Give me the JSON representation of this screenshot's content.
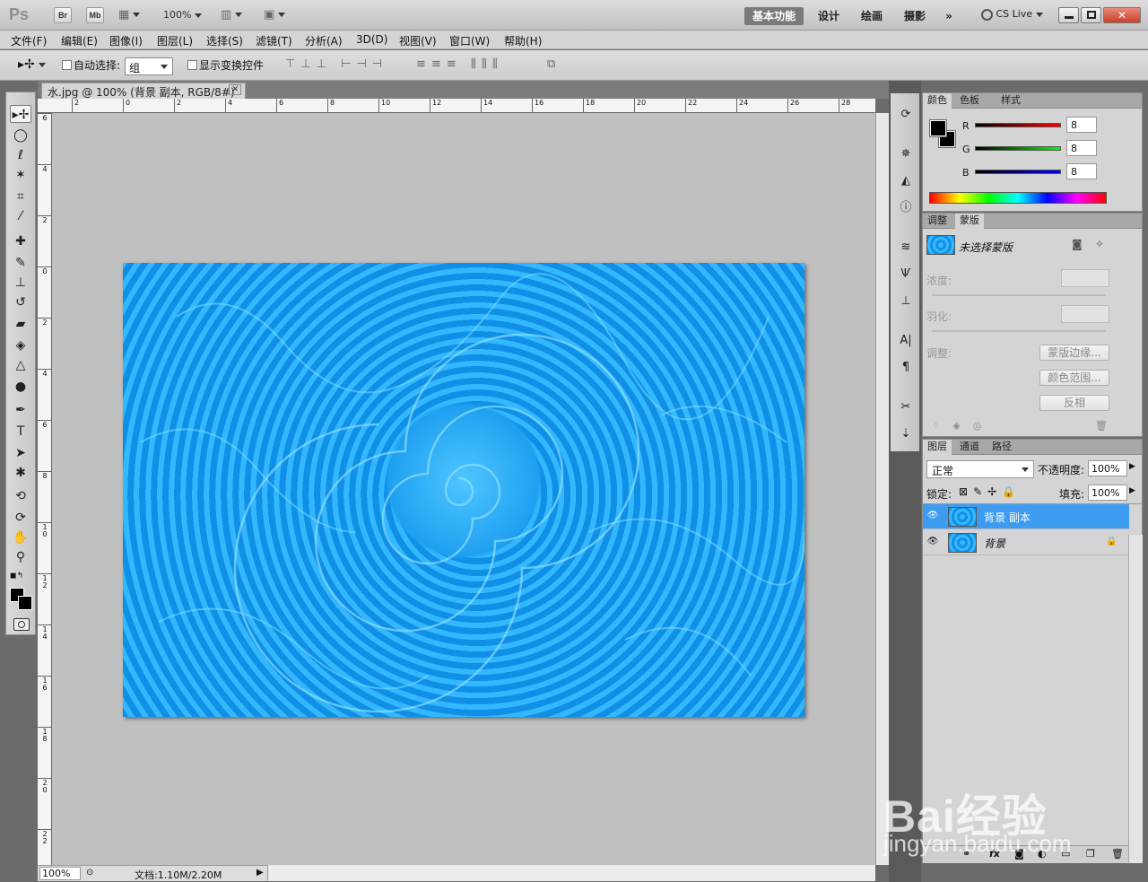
{
  "app": {
    "logo": "Ps",
    "br": "Br",
    "mb": "Mb",
    "zoom": "100%",
    "cslive": "CS Live"
  },
  "workspaces": [
    "基本功能",
    "设计",
    "绘画",
    "摄影"
  ],
  "menu": [
    "文件(F)",
    "编辑(E)",
    "图像(I)",
    "图层(L)",
    "选择(S)",
    "滤镜(T)",
    "分析(A)",
    "3D(D)",
    "视图(V)",
    "窗口(W)",
    "帮助(H)"
  ],
  "options": {
    "auto_select_label": "自动选择:",
    "auto_select_value": "组",
    "show_transform_label": "显示变换控件"
  },
  "document": {
    "tab": "水.jpg @ 100% (背景 副本, RGB/8#) *",
    "close": "✕"
  },
  "ruler_h": [
    "2",
    "0",
    "2",
    "4",
    "6",
    "8",
    "10",
    "12",
    "14",
    "16",
    "18",
    "20",
    "22",
    "24",
    "26",
    "28"
  ],
  "ruler_v": [
    "6",
    "4",
    "2",
    "0",
    "2",
    "4",
    "6",
    "8",
    "1\n0",
    "1\n2",
    "1\n4",
    "1\n6",
    "1\n8",
    "2\n0",
    "2\n2"
  ],
  "status": {
    "zoom": "100%",
    "doc": "文档:1.10M/2.20M"
  },
  "color_panel": {
    "tabs": [
      "颜色",
      "色板",
      "样式"
    ],
    "r_label": "R",
    "g_label": "G",
    "b_label": "B",
    "r": "8",
    "g": "8",
    "b": "8"
  },
  "mask_panel": {
    "tabs": [
      "调整",
      "蒙版"
    ],
    "no_mask": "未选择蒙版",
    "density": "浓度:",
    "feather": "羽化:",
    "refine": "调整:",
    "btn_edge": "蒙版边缘...",
    "btn_range": "颜色范围...",
    "btn_invert": "反相"
  },
  "layers_panel": {
    "tabs": [
      "图层",
      "通道",
      "路径"
    ],
    "blend": "正常",
    "opacity_label": "不透明度:",
    "opacity": "100%",
    "lock_label": "锁定:",
    "fill_label": "填充:",
    "fill": "100%",
    "layers": [
      {
        "name": "背景 副本",
        "selected": true
      },
      {
        "name": "背景",
        "selected": false
      }
    ]
  },
  "watermark": {
    "main": "Bai经验",
    "sub": "jingyan.baidu.com"
  }
}
